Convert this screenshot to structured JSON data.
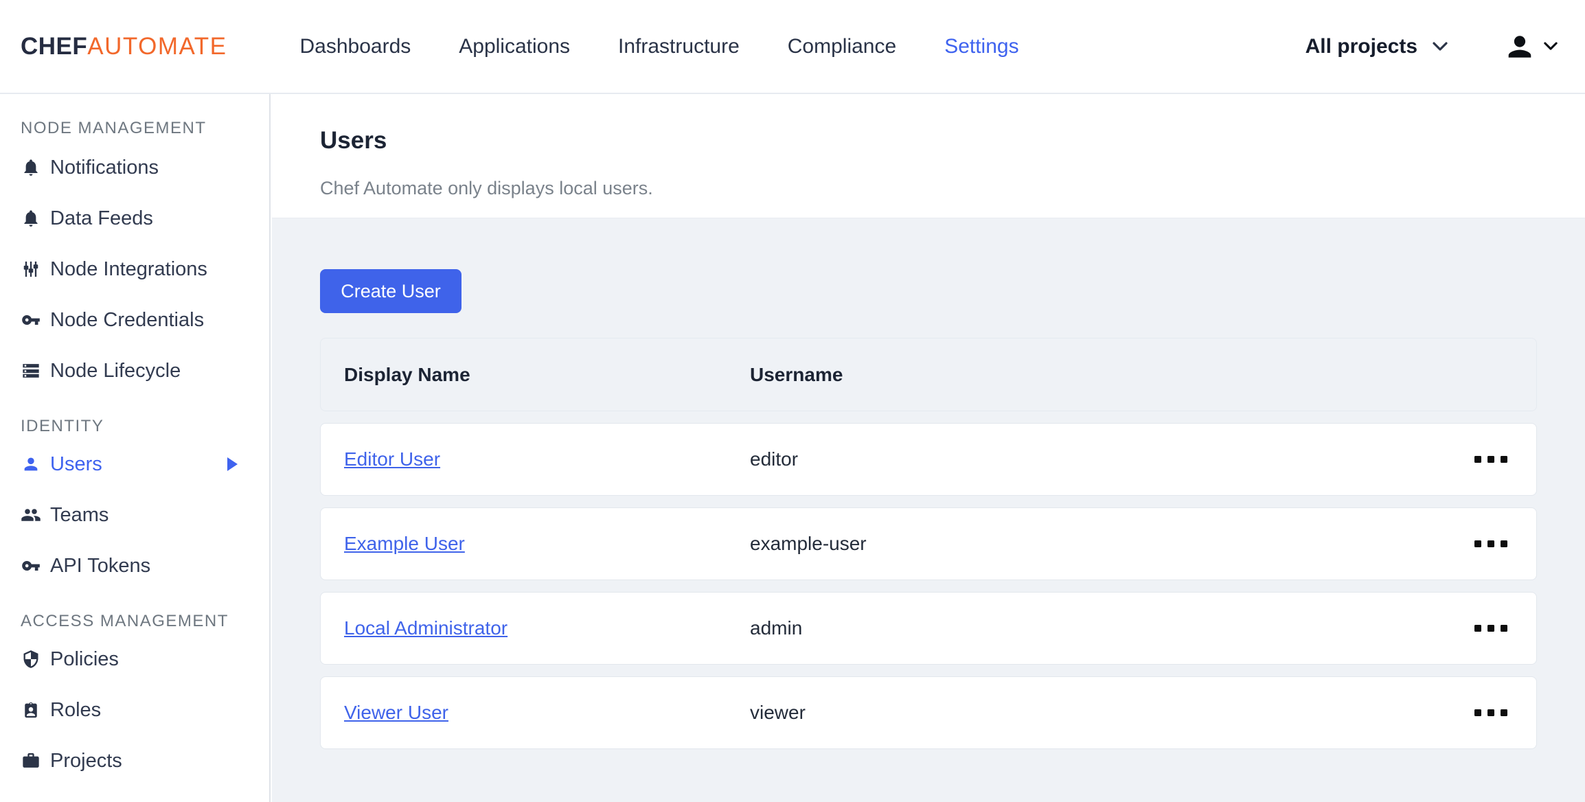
{
  "colors": {
    "brand_navy": "#252c41",
    "brand_orange": "#f2682b",
    "accent_blue": "#3f63ef",
    "page_background": "#eff2f6",
    "card_border": "#e2e7ed"
  },
  "header": {
    "logo_chef": "CHEF",
    "logo_automate": "AUTOMATE",
    "nav": [
      {
        "label": "Dashboards",
        "active": false
      },
      {
        "label": "Applications",
        "active": false
      },
      {
        "label": "Infrastructure",
        "active": false
      },
      {
        "label": "Compliance",
        "active": false
      },
      {
        "label": "Settings",
        "active": true
      }
    ],
    "projects_dropdown": {
      "label": "All projects",
      "icon": "chevron-down-icon"
    },
    "user_menu": {
      "avatar": "person-icon",
      "icon": "chevron-down-icon"
    }
  },
  "sidebar": {
    "sections": [
      {
        "title": "NODE MANAGEMENT",
        "items": [
          {
            "label": "Notifications",
            "icon": "bell-icon",
            "active": false
          },
          {
            "label": "Data Feeds",
            "icon": "bell-icon",
            "active": false
          },
          {
            "label": "Node Integrations",
            "icon": "sliders-icon",
            "active": false
          },
          {
            "label": "Node Credentials",
            "icon": "key-icon",
            "active": false
          },
          {
            "label": "Node Lifecycle",
            "icon": "storage-icon",
            "active": false
          }
        ]
      },
      {
        "title": "IDENTITY",
        "items": [
          {
            "label": "Users",
            "icon": "person-icon",
            "active": true,
            "has_submenu_arrow": true
          },
          {
            "label": "Teams",
            "icon": "group-icon",
            "active": false
          },
          {
            "label": "API Tokens",
            "icon": "key-icon",
            "active": false
          }
        ]
      },
      {
        "title": "ACCESS MANAGEMENT",
        "items": [
          {
            "label": "Policies",
            "icon": "shield-icon",
            "active": false
          },
          {
            "label": "Roles",
            "icon": "badge-icon",
            "active": false
          },
          {
            "label": "Projects",
            "icon": "briefcase-icon",
            "active": false
          }
        ]
      }
    ]
  },
  "main": {
    "page_title": "Users",
    "page_subtitle": "Chef Automate only displays local users.",
    "create_button_label": "Create User",
    "table": {
      "columns": [
        "Display Name",
        "Username"
      ],
      "row_menu_icon": "ellipsis-icon",
      "rows": [
        {
          "display_name": "Editor User",
          "username": "editor"
        },
        {
          "display_name": "Example User",
          "username": "example-user"
        },
        {
          "display_name": "Local Administrator",
          "username": "admin"
        },
        {
          "display_name": "Viewer User",
          "username": "viewer"
        }
      ]
    }
  }
}
